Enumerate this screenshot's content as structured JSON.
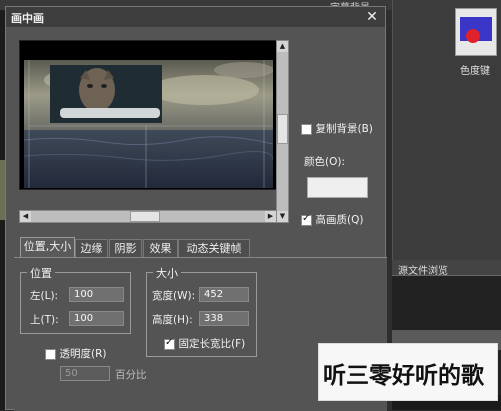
{
  "background": {
    "top_label": "字幕背景",
    "thumbnail_label": "色度键",
    "panel_tab": "源文件浏览"
  },
  "dialog": {
    "title": "画中画",
    "close_icon": "close-icon"
  },
  "options": {
    "copy_background": "复制背景(B)",
    "copy_background_checked": false,
    "color_label": "颜色(O):",
    "color_value": "#efefef",
    "high_quality": "高画质(Q)",
    "high_quality_checked": true
  },
  "tabs": [
    {
      "label": "位置,大小",
      "active": true
    },
    {
      "label": "边缘",
      "active": false
    },
    {
      "label": "阴影",
      "active": false
    },
    {
      "label": "效果",
      "active": false
    },
    {
      "label": "动态关键帧",
      "active": false
    }
  ],
  "position": {
    "title": "位置",
    "left_label": "左(L):",
    "left_value": "100",
    "top_label": "上(T):",
    "top_value": "100"
  },
  "size": {
    "title": "大小",
    "width_label": "宽度(W):",
    "width_value": "452",
    "height_label": "高度(H):",
    "height_value": "338",
    "lock_ratio_label": "固定长宽比(F)",
    "lock_ratio_checked": true
  },
  "transparency": {
    "label": "透明度(R)",
    "checked": false,
    "value": "50",
    "unit": "百分比"
  },
  "watermark": {
    "text": "听三零好听的歌"
  }
}
